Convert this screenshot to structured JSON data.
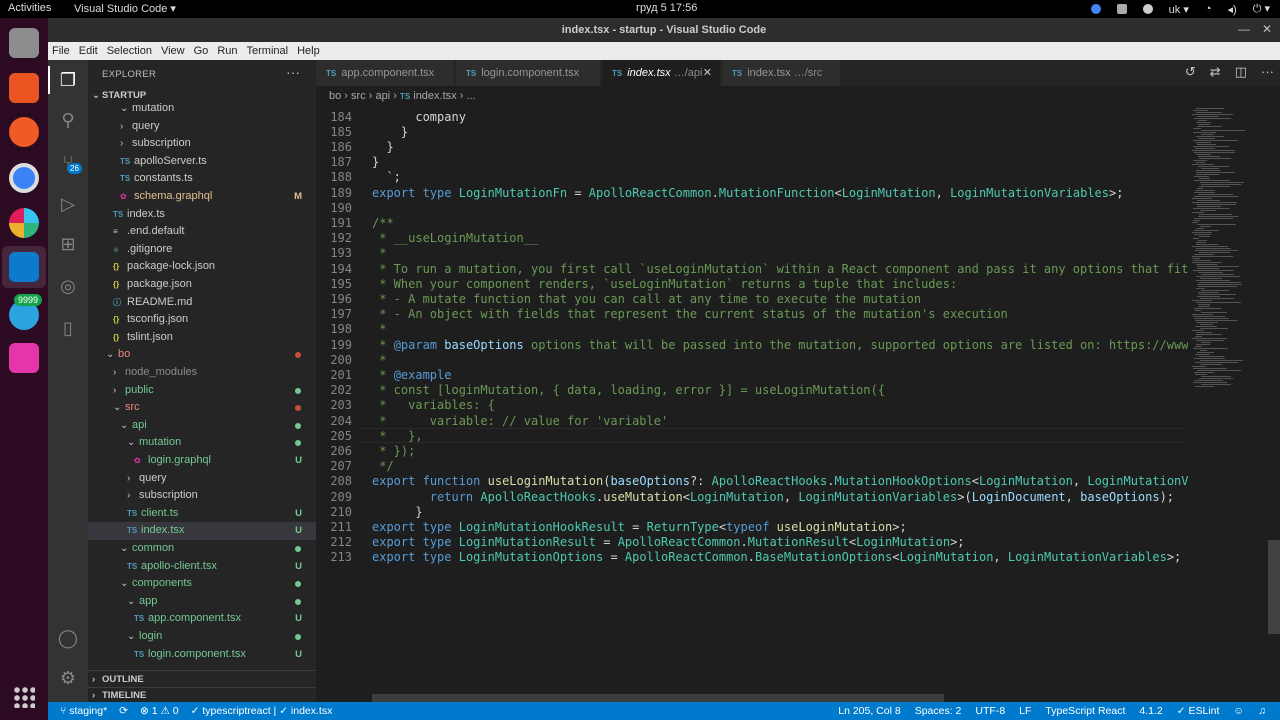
{
  "topbar": {
    "activities": "Activities",
    "app_name": "Visual Studio Code ▾",
    "clock": "груд 5  17:56",
    "keyboard": "uk ▾"
  },
  "dock": {
    "telegram_badge": "9999"
  },
  "window": {
    "title": "index.tsx - startup - Visual Studio Code",
    "minimize": "—",
    "close": "✕"
  },
  "menubar": [
    "File",
    "Edit",
    "Selection",
    "View",
    "Go",
    "Run",
    "Terminal",
    "Help"
  ],
  "activity_bar": {
    "scm_badge": "26"
  },
  "sidebar": {
    "header": "EXPLORER",
    "more": "···",
    "project": "STARTUP",
    "outline": "OUTLINE",
    "timeline": "TIMELINE",
    "tree": [
      {
        "label": "mutation",
        "depth": 2,
        "kind": "folder-open",
        "cut": true
      },
      {
        "label": "query",
        "depth": 2,
        "kind": "folder"
      },
      {
        "label": "subscription",
        "depth": 2,
        "kind": "folder"
      },
      {
        "label": "apolloServer.ts",
        "depth": 2,
        "kind": "ts"
      },
      {
        "label": "constants.ts",
        "depth": 2,
        "kind": "ts"
      },
      {
        "label": "schema.graphql",
        "depth": 2,
        "kind": "gql",
        "badge": "M",
        "color": "#e2c08d"
      },
      {
        "label": "index.ts",
        "depth": 1,
        "kind": "ts"
      },
      {
        "label": ".end.default",
        "depth": 1,
        "kind": "txt"
      },
      {
        "label": ".gitignore",
        "depth": 1,
        "kind": "git"
      },
      {
        "label": "package-lock.json",
        "depth": 1,
        "kind": "json"
      },
      {
        "label": "package.json",
        "depth": 1,
        "kind": "json"
      },
      {
        "label": "README.md",
        "depth": 1,
        "kind": "md"
      },
      {
        "label": "tsconfig.json",
        "depth": 1,
        "kind": "json"
      },
      {
        "label": "tslint.json",
        "depth": 1,
        "kind": "json"
      },
      {
        "label": "bo",
        "depth": 0,
        "kind": "folder-open",
        "dot": "#c74e39",
        "color": "#e78a7a"
      },
      {
        "label": "node_modules",
        "depth": 1,
        "kind": "folder",
        "color": "#8c8c8c"
      },
      {
        "label": "public",
        "depth": 1,
        "kind": "folder",
        "dot": "#73c991",
        "color": "#73c991"
      },
      {
        "label": "src",
        "depth": 1,
        "kind": "folder-open",
        "dot": "#c74e39",
        "color": "#e78a7a"
      },
      {
        "label": "api",
        "depth": 2,
        "kind": "folder-open",
        "dot": "#73c991",
        "color": "#73c991"
      },
      {
        "label": "mutation",
        "depth": 3,
        "kind": "folder-open",
        "dot": "#73c991",
        "color": "#73c991"
      },
      {
        "label": "login.graphql",
        "depth": 4,
        "kind": "gql",
        "badge": "U",
        "color": "#73c991"
      },
      {
        "label": "query",
        "depth": 3,
        "kind": "folder"
      },
      {
        "label": "subscription",
        "depth": 3,
        "kind": "folder"
      },
      {
        "label": "client.ts",
        "depth": 3,
        "kind": "ts",
        "badge": "U",
        "color": "#73c991"
      },
      {
        "label": "index.tsx",
        "depth": 3,
        "kind": "ts",
        "badge": "U",
        "color": "#73c991",
        "selected": true
      },
      {
        "label": "common",
        "depth": 2,
        "kind": "folder-open",
        "dot": "#73c991",
        "color": "#73c991"
      },
      {
        "label": "apollo-client.tsx",
        "depth": 3,
        "kind": "ts",
        "badge": "U",
        "color": "#73c991"
      },
      {
        "label": "components",
        "depth": 2,
        "kind": "folder-open",
        "dot": "#73c991",
        "color": "#73c991"
      },
      {
        "label": "app",
        "depth": 3,
        "kind": "folder-open",
        "dot": "#73c991",
        "color": "#73c991"
      },
      {
        "label": "app.component.tsx",
        "depth": 4,
        "kind": "ts",
        "badge": "U",
        "color": "#73c991"
      },
      {
        "label": "login",
        "depth": 3,
        "kind": "folder-open",
        "dot": "#73c991",
        "color": "#73c991"
      },
      {
        "label": "login.component.tsx",
        "depth": 4,
        "kind": "ts",
        "badge": "U",
        "color": "#73c991"
      }
    ]
  },
  "tabs": [
    {
      "icon": "TS",
      "label": "app.component.tsx",
      "desc": "",
      "active": false
    },
    {
      "icon": "TS",
      "label": "login.component.tsx",
      "desc": "",
      "active": false
    },
    {
      "icon": "TS",
      "label": "index.tsx",
      "desc": " …/api",
      "active": true
    },
    {
      "icon": "TS",
      "label": "index.tsx",
      "desc": " …/src",
      "active": false
    }
  ],
  "breadcrumb": {
    "parts": [
      "bo",
      "src",
      "api"
    ],
    "file_icon": "TS",
    "file": "index.tsx",
    "tail": "..."
  },
  "editor": {
    "first_line": 184,
    "lines": [
      [
        [
          "      company",
          ""
        ]
      ],
      [
        [
          "    }",
          ""
        ]
      ],
      [
        [
          "  }",
          ""
        ]
      ],
      [
        [
          "}",
          ""
        ]
      ],
      [
        [
          "  `;",
          ""
        ]
      ],
      [
        [
          "export",
          "kw"
        ],
        [
          " ",
          ""
        ],
        [
          "type",
          "kw"
        ],
        [
          " ",
          ""
        ],
        [
          "LoginMutationFn",
          "ty"
        ],
        [
          " = ",
          ""
        ],
        [
          "ApolloReactCommon",
          "ty"
        ],
        [
          ".",
          ""
        ],
        [
          "MutationFunction",
          "ty"
        ],
        [
          "<",
          ""
        ],
        [
          "LoginMutation",
          "ty"
        ],
        [
          ", ",
          ""
        ],
        [
          "LoginMutationVariables",
          "ty"
        ],
        [
          ">;",
          ""
        ]
      ],
      [
        [
          "",
          ""
        ]
      ],
      [
        [
          "/**",
          "cm"
        ]
      ],
      [
        [
          " * __useLoginMutation__",
          "cm"
        ]
      ],
      [
        [
          " *",
          "cm"
        ]
      ],
      [
        [
          " * To run a mutation, you first call `useLoginMutation` within a React component and pass it any options that fit your needs.",
          "cm"
        ]
      ],
      [
        [
          " * When your component renders, `useLoginMutation` returns a tuple that includes:",
          "cm"
        ]
      ],
      [
        [
          " * - A mutate function that you can call at any time to execute the mutation",
          "cm"
        ]
      ],
      [
        [
          " * - An object with fields that represent the current status of the mutation's execution",
          "cm"
        ]
      ],
      [
        [
          " *",
          "cm"
        ]
      ],
      [
        [
          " * ",
          "cm"
        ],
        [
          "@param",
          "cmtag"
        ],
        [
          " ",
          ""
        ],
        [
          "baseOptions",
          "cmp"
        ],
        [
          " options that will be passed into the mutation, supported options are listed on: https://www.apollographql.com",
          "cm"
        ]
      ],
      [
        [
          " *",
          "cm"
        ]
      ],
      [
        [
          " * ",
          "cm"
        ],
        [
          "@example",
          "cmtag"
        ]
      ],
      [
        [
          " * const [loginMutation, { data, loading, error }] = useLoginMutation({",
          "cm"
        ]
      ],
      [
        [
          " *   variables: {",
          "cm"
        ]
      ],
      [
        [
          " *      variable: // value for 'variable'",
          "cm"
        ]
      ],
      [
        [
          " *   },",
          "cm"
        ]
      ],
      [
        [
          " * });",
          "cm"
        ]
      ],
      [
        [
          " */",
          "cm"
        ]
      ],
      [
        [
          "export",
          "kw"
        ],
        [
          " ",
          ""
        ],
        [
          "function",
          "kw"
        ],
        [
          " ",
          ""
        ],
        [
          "useLoginMutation",
          "fn"
        ],
        [
          "(",
          ""
        ],
        [
          "baseOptions",
          "vr"
        ],
        [
          "?: ",
          ""
        ],
        [
          "ApolloReactHooks",
          "ty"
        ],
        [
          ".",
          ""
        ],
        [
          "MutationHookOptions",
          "ty"
        ],
        [
          "<",
          ""
        ],
        [
          "LoginMutation",
          "ty"
        ],
        [
          ", ",
          ""
        ],
        [
          "LoginMutationVariables",
          "ty"
        ],
        [
          ">) {",
          ""
        ]
      ],
      [
        [
          "        ",
          ""
        ],
        [
          "return",
          "kw"
        ],
        [
          " ",
          ""
        ],
        [
          "ApolloReactHooks",
          "ty"
        ],
        [
          ".",
          ""
        ],
        [
          "useMutation",
          "fn"
        ],
        [
          "<",
          ""
        ],
        [
          "LoginMutation",
          "ty"
        ],
        [
          ", ",
          ""
        ],
        [
          "LoginMutationVariables",
          "ty"
        ],
        [
          ">(",
          ""
        ],
        [
          "LoginDocument",
          "vr"
        ],
        [
          ", ",
          ""
        ],
        [
          "baseOptions",
          "vr"
        ],
        [
          ");",
          ""
        ]
      ],
      [
        [
          "      }",
          ""
        ]
      ],
      [
        [
          "export",
          "kw"
        ],
        [
          " ",
          ""
        ],
        [
          "type",
          "kw"
        ],
        [
          " ",
          ""
        ],
        [
          "LoginMutationHookResult",
          "ty"
        ],
        [
          " = ",
          ""
        ],
        [
          "ReturnType",
          "ty"
        ],
        [
          "<",
          ""
        ],
        [
          "typeof",
          "kw"
        ],
        [
          " ",
          ""
        ],
        [
          "useLoginMutation",
          "fn"
        ],
        [
          ">;",
          ""
        ]
      ],
      [
        [
          "export",
          "kw"
        ],
        [
          " ",
          ""
        ],
        [
          "type",
          "kw"
        ],
        [
          " ",
          ""
        ],
        [
          "LoginMutationResult",
          "ty"
        ],
        [
          " = ",
          ""
        ],
        [
          "ApolloReactCommon",
          "ty"
        ],
        [
          ".",
          ""
        ],
        [
          "MutationResult",
          "ty"
        ],
        [
          "<",
          ""
        ],
        [
          "LoginMutation",
          "ty"
        ],
        [
          ">;",
          ""
        ]
      ],
      [
        [
          "export",
          "kw"
        ],
        [
          " ",
          ""
        ],
        [
          "type",
          "kw"
        ],
        [
          " ",
          ""
        ],
        [
          "LoginMutationOptions",
          "ty"
        ],
        [
          " = ",
          ""
        ],
        [
          "ApolloReactCommon",
          "ty"
        ],
        [
          ".",
          ""
        ],
        [
          "BaseMutationOptions",
          "ty"
        ],
        [
          "<",
          ""
        ],
        [
          "LoginMutation",
          "ty"
        ],
        [
          ", ",
          ""
        ],
        [
          "LoginMutationVariables",
          "ty"
        ],
        [
          ">;",
          ""
        ]
      ]
    ]
  },
  "statusbar": {
    "branch": "staging*",
    "errors": "⊗ 1 ⚠ 0",
    "lang_hint": "✓ typescriptreact | ✓ index.tsx",
    "position": "Ln 205, Col 8",
    "spaces": "Spaces: 2",
    "encoding": "UTF-8",
    "eol": "LF",
    "language": "TypeScript React",
    "version": "4.1.2",
    "eslint": "✓ ESLint"
  },
  "colors": {
    "accent": "#007acc",
    "untracked": "#73c991",
    "modified": "#e2c08d",
    "deleted": "#c74e39"
  }
}
